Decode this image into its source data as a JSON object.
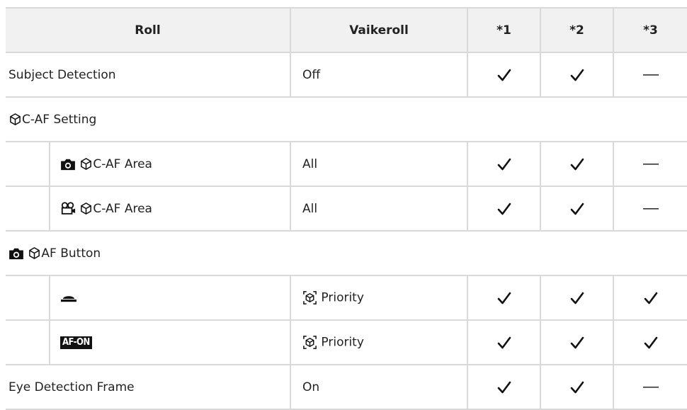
{
  "header": {
    "col_roll": "Roll",
    "col_default": "Vaikeroll",
    "col1": "*1",
    "col2": "*2",
    "col3": "*3"
  },
  "rows": [
    {
      "label": "Subject Detection",
      "value": "Off",
      "c1": "check",
      "c2": "check",
      "c3": "dash"
    },
    {
      "section_label": "C-AF Setting",
      "icons": [
        "subject-detect-icon"
      ]
    },
    {
      "label": "C-AF Area",
      "icons": [
        "camera-icon",
        "subject-detect-icon"
      ],
      "value": "All",
      "c1": "check",
      "c2": "check",
      "c3": "dash"
    },
    {
      "label": "C-AF Area",
      "icons": [
        "movie-icon",
        "subject-detect-icon"
      ],
      "value": "All",
      "c1": "check",
      "c2": "check",
      "c3": "dash"
    },
    {
      "section_label": "AF Button",
      "icons": [
        "camera-icon",
        "subject-detect-icon"
      ]
    },
    {
      "label": "",
      "icons": [
        "shutter-button-icon"
      ],
      "value": "Priority",
      "value_icon": "subject-priority-icon",
      "c1": "check",
      "c2": "check",
      "c3": "check"
    },
    {
      "label": "",
      "icons": [
        "af-on-button-icon"
      ],
      "af_on_text": "AF-ON",
      "value": "Priority",
      "value_icon": "subject-priority-icon",
      "c1": "check",
      "c2": "check",
      "c3": "check"
    },
    {
      "label": "Eye Detection Frame",
      "value": "On",
      "c1": "check",
      "c2": "check",
      "c3": "dash"
    }
  ]
}
